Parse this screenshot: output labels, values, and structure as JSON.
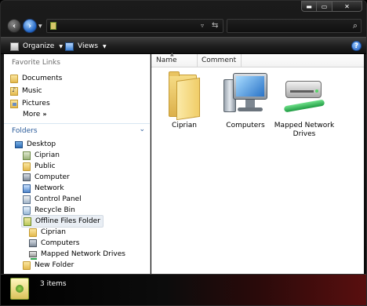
{
  "window": {
    "caption": {
      "minimize": "▬",
      "maximize": "▭",
      "close": "✕"
    }
  },
  "navigation": {
    "back_icon": "back-arrow",
    "forward_icon": "forward-arrow",
    "back_glyph": "‹",
    "forward_glyph": "›",
    "dropdown_glyph": "▼",
    "address_value": "",
    "address_dropdown_glyph": "▿",
    "refresh_glyph": "⇆",
    "search_value": "",
    "search_glyph": "⌕"
  },
  "toolbar": {
    "organize_label": "Organize",
    "views_label": "Views",
    "caret": "▼",
    "help_glyph": "?"
  },
  "favorite_links": {
    "title": "Favorite Links",
    "items": [
      {
        "label": "Documents",
        "icon": "folder-icon"
      },
      {
        "label": "Music",
        "icon": "music-folder-icon"
      },
      {
        "label": "Pictures",
        "icon": "pictures-folder-icon"
      }
    ],
    "more_label": "More",
    "more_glyph": "»"
  },
  "folders": {
    "title": "Folders",
    "chevron": "⌄",
    "tree": [
      {
        "label": "Desktop",
        "icon": "desktop-icon",
        "level": 0
      },
      {
        "label": "Ciprian",
        "icon": "user-folder-icon",
        "level": 1
      },
      {
        "label": "Public",
        "icon": "folder-icon",
        "level": 1
      },
      {
        "label": "Computer",
        "icon": "computer-icon",
        "level": 1
      },
      {
        "label": "Network",
        "icon": "network-icon",
        "level": 1
      },
      {
        "label": "Control Panel",
        "icon": "control-panel-icon",
        "level": 1
      },
      {
        "label": "Recycle Bin",
        "icon": "recycle-bin-icon",
        "level": 1
      },
      {
        "label": "Offline Files Folder",
        "icon": "offline-files-icon",
        "level": 1,
        "selected": true
      },
      {
        "label": "Ciprian",
        "icon": "folder-icon",
        "level": 2
      },
      {
        "label": "Computers",
        "icon": "computer-icon",
        "level": 2
      },
      {
        "label": "Mapped Network Drives",
        "icon": "mapped-drive-icon",
        "level": 2
      },
      {
        "label": "New Folder",
        "icon": "folder-icon",
        "level": 1
      }
    ]
  },
  "content": {
    "columns": {
      "name": "Name",
      "comment": "Comment",
      "sort_glyph": "▲"
    },
    "items": [
      {
        "label": "Ciprian",
        "icon": "folder-icon"
      },
      {
        "label": "Computers",
        "icon": "computer-icon"
      },
      {
        "label": "Mapped Network Drives",
        "icon": "mapped-drive-icon"
      }
    ]
  },
  "statusbar": {
    "icon": "offline-files-icon",
    "text": "3 items"
  }
}
